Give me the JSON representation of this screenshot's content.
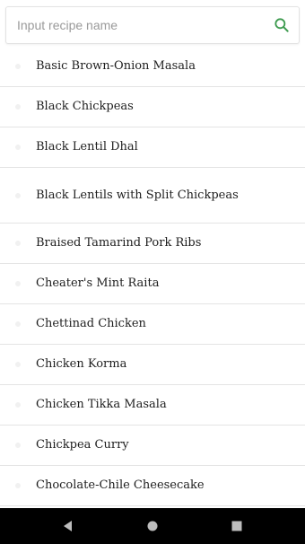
{
  "search": {
    "placeholder": "Input recipe name",
    "value": "",
    "icon": "search-icon",
    "icon_color": "#3c9a4e"
  },
  "recipes": [
    "Basic Brown-Onion Masala",
    "Black Chickpeas",
    "Black Lentil Dhal",
    "Black Lentils with Split Chickpeas",
    "Braised Tamarind Pork Ribs",
    "Cheater's Mint Raita",
    "Chettinad Chicken",
    "Chicken Korma",
    "Chicken Tikka Masala",
    "Chickpea Curry",
    "Chocolate-Chile Cheesecake"
  ],
  "navbar": {
    "background": "#000000",
    "icon_color": "#bdbdbd",
    "buttons": [
      "back-icon",
      "home-icon",
      "recents-icon"
    ]
  }
}
